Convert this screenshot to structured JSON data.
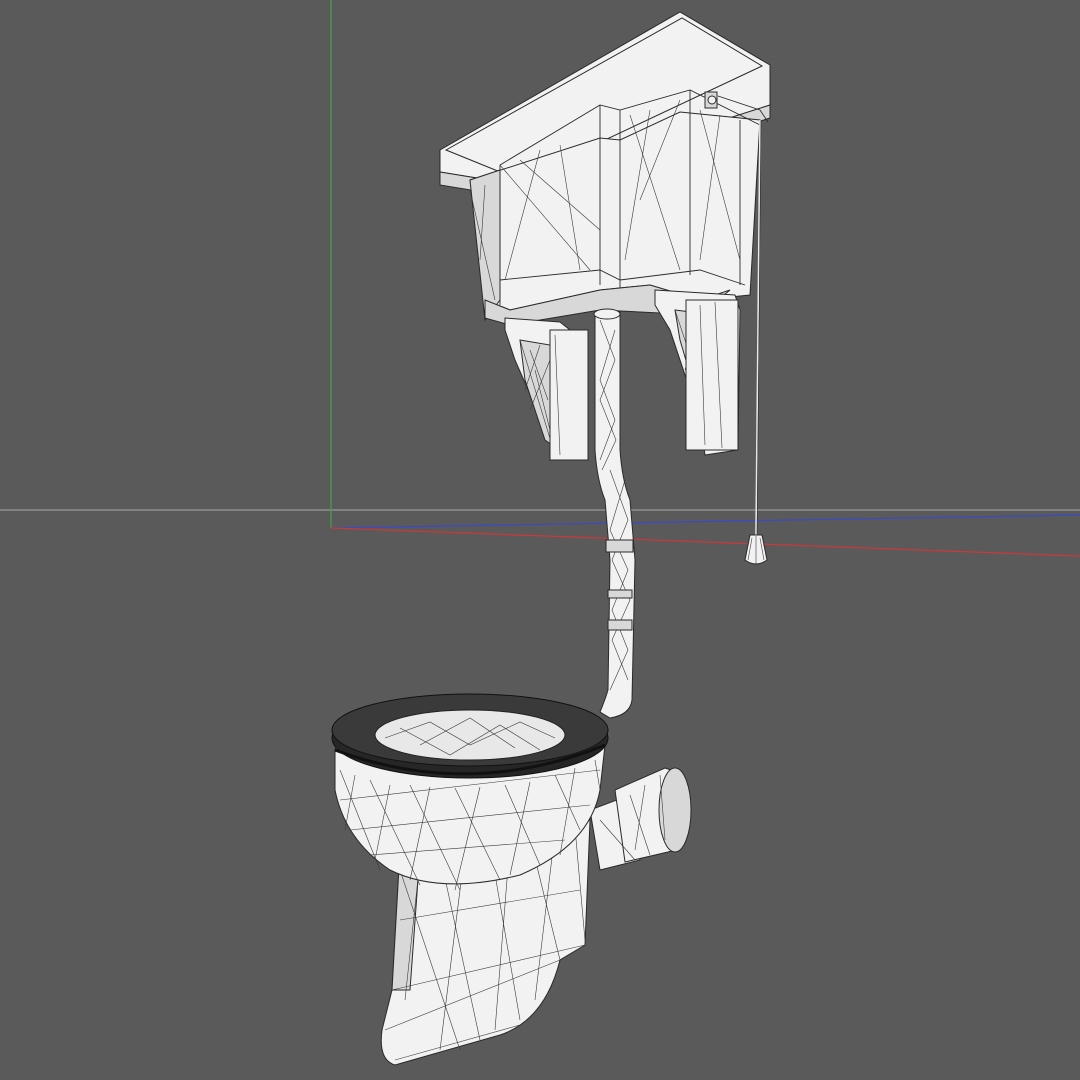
{
  "viewport": {
    "background_color": "#5a5a5a",
    "axis_colors": {
      "x_axis": "#c83a3a",
      "y_axis": "#3ea84a",
      "z_axis": "#3a4ac8",
      "horizon": "#b0b0b0"
    }
  },
  "model": {
    "description_icon": "toilet-wireframe-icon",
    "parts": [
      "cistern",
      "cistern-brackets",
      "flush-pipe",
      "pull-chain",
      "pull-handle",
      "bowl",
      "seat",
      "pedestal",
      "outlet-pipe"
    ],
    "render_style": "wireframe-on-shaded"
  }
}
